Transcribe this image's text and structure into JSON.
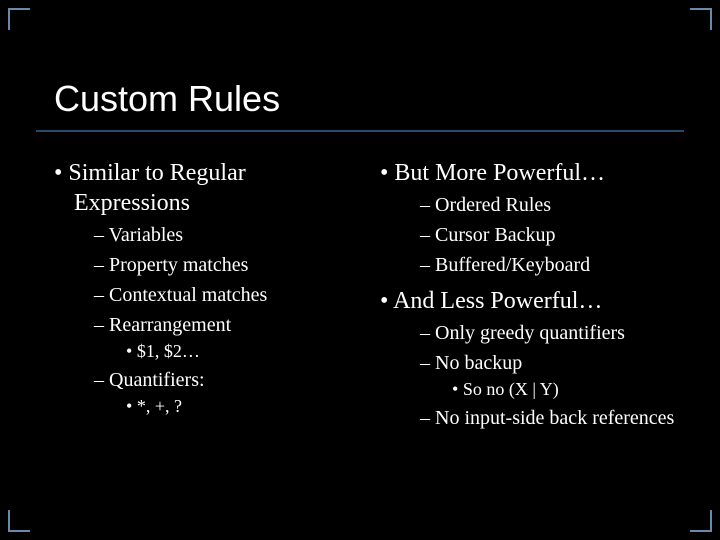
{
  "title": "Custom Rules",
  "left": {
    "h1": "Similar to Regular Expressions",
    "sub": [
      "Variables",
      "Property matches",
      "Contextual matches",
      "Rearrangement"
    ],
    "rearr_note": "$1, $2…",
    "quant": "Quantifiers:",
    "quant_note": "*, +, ?"
  },
  "right": {
    "more": "But More Powerful…",
    "more_sub": [
      "Ordered Rules",
      "Cursor Backup",
      "Buffered/Keyboard"
    ],
    "less": "And Less Powerful…",
    "less_sub1": "Only greedy quantifiers",
    "less_sub2": "No backup",
    "less_note": "So no (X | Y)",
    "less_sub3": "No input-side back references"
  }
}
